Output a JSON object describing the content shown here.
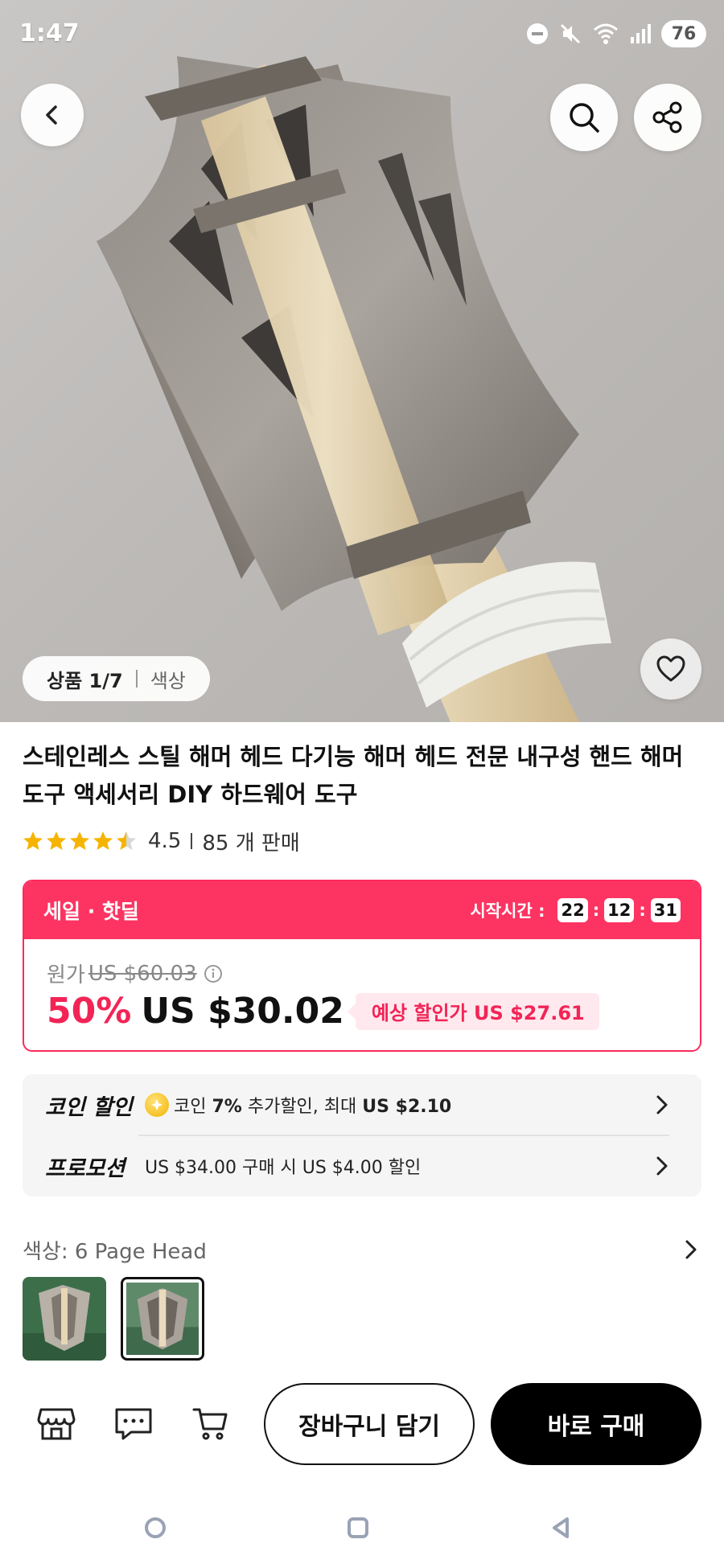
{
  "status_bar": {
    "time": "1:47",
    "battery": "76"
  },
  "hero": {
    "counter_main": "상품 1/7",
    "counter_sub": "색상"
  },
  "product": {
    "title": "스테인레스 스틸 해머 헤드 다기능 해머 헤드 전문 내구성 핸드 해머 도구 액세서리 DIY 하드웨어 도구",
    "rating": "4.5",
    "rating_stars": 4.5,
    "sold": "85 개 판매"
  },
  "sale": {
    "title": "세일 · 핫딜",
    "timer_label": "시작시간 :",
    "timer": {
      "hours": "22",
      "minutes": "12",
      "seconds": "31"
    },
    "orig_label": "원가",
    "orig_price": "US $60.03",
    "discount": "50%",
    "price": "US $30.02",
    "estimate": "예상 할인가 US $27.61"
  },
  "promotions": {
    "coin_label": "코인 할인",
    "coin_text_prefix": "코인 ",
    "coin_percent": "7%",
    "coin_text_mid": " 추가할인, 최대 ",
    "coin_max": "US $2.10",
    "promo_label": "프로모션",
    "promo_text": "US $34.00 구매 시 US $4.00 할인"
  },
  "color": {
    "label": "색상: 6 Page Head"
  },
  "actions": {
    "add_to_cart": "장바구니 담기",
    "buy_now": "바로 구매"
  },
  "icons": [
    "back-arrow-icon",
    "search-icon",
    "share-icon",
    "heart-icon",
    "store-icon",
    "chat-icon",
    "cart-icon",
    "info-icon",
    "chevron-right-icon",
    "coin-icon"
  ],
  "colors": {
    "accent": "#fd3462",
    "estimate_bg": "#ffe9ee",
    "star": "#f6b400"
  }
}
